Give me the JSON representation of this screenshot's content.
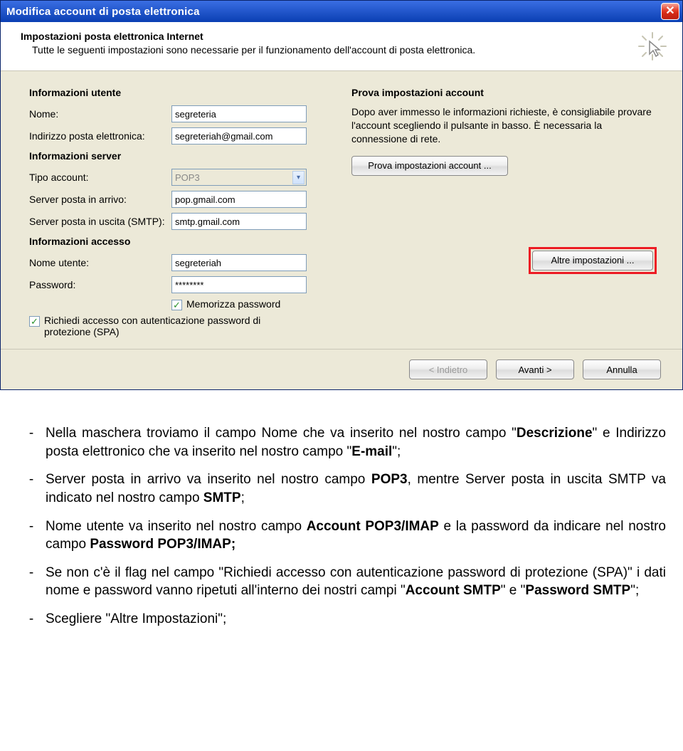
{
  "titlebar": {
    "title": "Modifica account di posta elettronica"
  },
  "header": {
    "title": "Impostazioni posta elettronica Internet",
    "subtitle": "Tutte le seguenti impostazioni sono necessarie per il funzionamento dell'account di posta elettronica."
  },
  "left": {
    "sec_user": "Informazioni utente",
    "name_label": "Nome:",
    "name_value": "segreteria",
    "email_label": "Indirizzo posta elettronica:",
    "email_value": "segreteriah@gmail.com",
    "sec_server": "Informazioni server",
    "acct_type_label": "Tipo account:",
    "acct_type_value": "POP3",
    "in_label": "Server posta in arrivo:",
    "in_value": "pop.gmail.com",
    "out_label": "Server posta in uscita (SMTP):",
    "out_value": "smtp.gmail.com",
    "sec_login": "Informazioni accesso",
    "user_label": "Nome utente:",
    "user_value": "segreteriah",
    "pass_label": "Password:",
    "pass_value": "********",
    "remember_label": "Memorizza password",
    "spa_label": "Richiedi accesso con autenticazione password di protezione (SPA)"
  },
  "right": {
    "sec_test": "Prova impostazioni account",
    "desc": "Dopo aver immesso le informazioni richieste, è consigliabile provare l'account scegliendo il pulsante in basso. È necessaria la connessione di rete.",
    "test_btn": "Prova impostazioni account ...",
    "more_btn": "Altre impostazioni ..."
  },
  "footer": {
    "back": "< Indietro",
    "next": "Avanti >",
    "cancel": "Annulla"
  },
  "notes": {
    "b1a": "Nella maschera troviamo il campo Nome che va inserito nel nostro campo \"",
    "b1b": "Descrizione",
    "b1c": "\" e Indirizzo posta elettronico che va inserito nel nostro campo \"",
    "b1d": "E-mail",
    "b1e": "\";",
    "b2a": "Server posta in arrivo va inserito nel nostro campo ",
    "b2b": "POP3",
    "b2c": ", mentre Server posta in uscita SMTP va indicato nel nostro campo ",
    "b2d": "SMTP",
    "b2e": ";",
    "b3a": "Nome utente va inserito nel nostro campo ",
    "b3b": "Account POP3/IMAP",
    "b3c": " e la password da indicare nel nostro campo ",
    "b3d": "Password POP3/IMAP;",
    "b4a": "Se non c'è il flag nel campo \"Richiedi accesso con autenticazione password di protezione (SPA)\" i dati nome e password vanno ripetuti all'interno dei nostri campi \"",
    "b4b": "Account SMTP",
    "b4c": "\" e \"",
    "b4d": "Password SMTP",
    "b4e": "\";",
    "b5": "Scegliere \"Altre Impostazioni\";"
  }
}
